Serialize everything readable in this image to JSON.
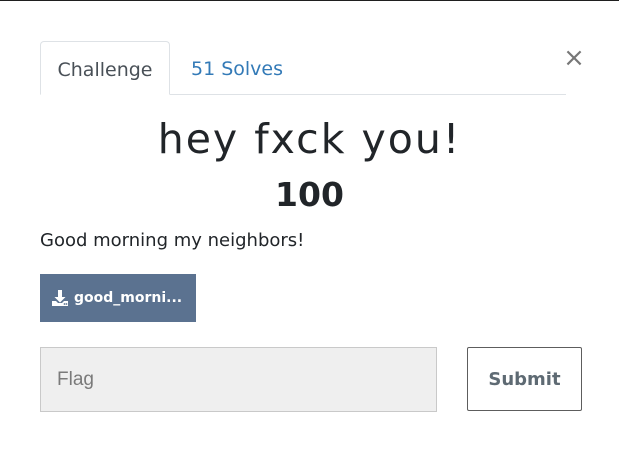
{
  "tabs": {
    "challenge_label": "Challenge",
    "solves_label": "51 Solves"
  },
  "close_icon": "close-icon",
  "challenge": {
    "name": "hey fxck you!",
    "value": "100",
    "description": "Good morning my neighbors!"
  },
  "file": {
    "icon": "download-icon",
    "label": "good_morning_neighbors.zip",
    "display_label": "good_morni..."
  },
  "flag_input": {
    "placeholder": "Flag",
    "value": ""
  },
  "submit_label": "Submit",
  "colors": {
    "file_button_bg": "#5b7290",
    "link": "#337ab7",
    "input_bg": "#efefef"
  }
}
